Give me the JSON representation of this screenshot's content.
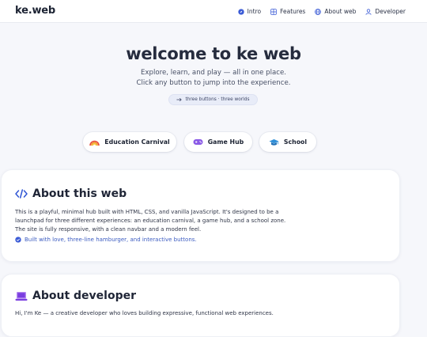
{
  "brand": "ke.web",
  "nav": [
    {
      "label": "Intro",
      "icon": "compass-icon"
    },
    {
      "label": "Features",
      "icon": "grid-icon"
    },
    {
      "label": "About web",
      "icon": "globe-icon"
    },
    {
      "label": "Developer",
      "icon": "user-icon"
    }
  ],
  "hero": {
    "title": "welcome to ke web",
    "line1": "Explore, learn, and play — all in one place.",
    "line2": "Click any button to jump into the experience.",
    "pill": "three buttons · three worlds"
  },
  "buttons": [
    {
      "label": "Education Carnival",
      "icon": "rainbow-icon"
    },
    {
      "label": "Game Hub",
      "icon": "gamepad-icon"
    },
    {
      "label": "School",
      "icon": "graduation-cap-icon"
    }
  ],
  "about": {
    "title": "About this web",
    "p1": "This is a playful, minimal hub built with HTML, CSS, and vanilla JavaScript. It's designed to be a",
    "p2": "launchpad for three different experiences: an education carnival, a game hub, and a school zone.",
    "p3": "The site is fully responsive, with a clean navbar and a modern feel.",
    "note": "Built with love, three-line hamburger, and interactive buttons."
  },
  "developer": {
    "title": "About developer",
    "p1": "Hi, I'm Ke — a creative developer who loves building expressive, functional web experiences."
  },
  "colors": {
    "accent": "#3b5bc0",
    "code_icon": "#2f55d4",
    "laptop_icon": "#7a3ee0"
  }
}
